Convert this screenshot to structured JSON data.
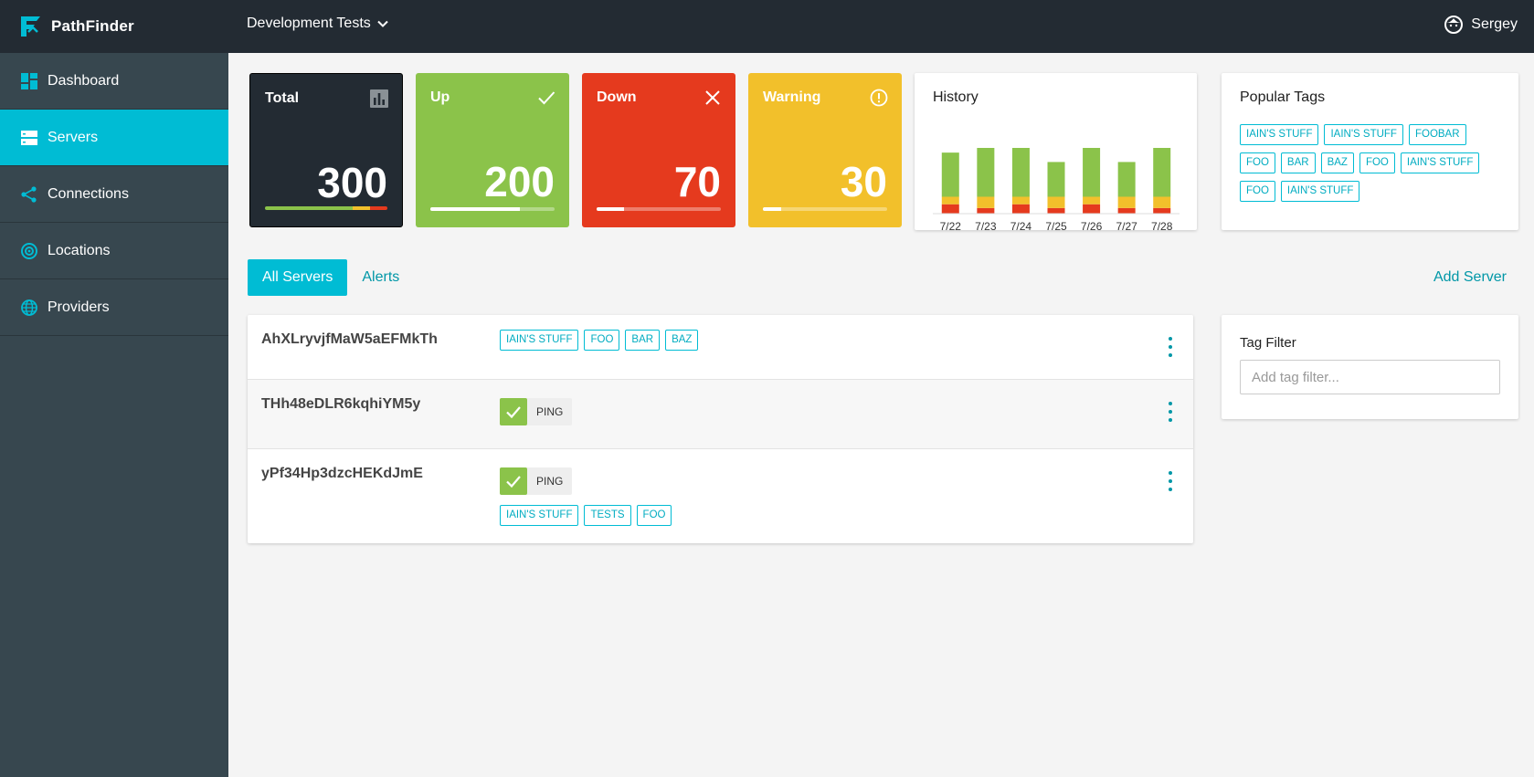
{
  "app": {
    "name": "PathFinder"
  },
  "header": {
    "project": "Development Tests",
    "user": "Sergey"
  },
  "sidebar": {
    "items": [
      {
        "label": "Dashboard",
        "icon": "dashboard-icon",
        "active": false
      },
      {
        "label": "Servers",
        "icon": "servers-icon",
        "active": true
      },
      {
        "label": "Connections",
        "icon": "share-icon",
        "active": false
      },
      {
        "label": "Locations",
        "icon": "location-icon",
        "active": false
      },
      {
        "label": "Providers",
        "icon": "globe-icon",
        "active": false
      }
    ]
  },
  "stats": {
    "total": {
      "title": "Total",
      "value": "300",
      "icon": "bar-chart-icon",
      "breakdown": {
        "up": 0.72,
        "warning": 0.14,
        "down": 0.14
      }
    },
    "up": {
      "title": "Up",
      "value": "200",
      "icon": "check-icon",
      "progress": 0.72
    },
    "down": {
      "title": "Down",
      "value": "70",
      "icon": "close-icon",
      "progress": 0.22
    },
    "warning": {
      "title": "Warning",
      "value": "30",
      "icon": "alert-circle-icon",
      "progress": 0.15
    }
  },
  "history": {
    "title": "History",
    "chart_data": {
      "type": "bar",
      "stacked": true,
      "categories": [
        "7/22",
        "7/23",
        "7/24",
        "7/25",
        "7/26",
        "7/27",
        "7/28"
      ],
      "series": [
        {
          "color": "#e53a1e",
          "values": [
            10,
            6,
            10,
            6,
            10,
            6,
            6
          ]
        },
        {
          "color": "#f2c02b",
          "values": [
            8,
            12,
            8,
            12,
            8,
            12,
            12
          ]
        },
        {
          "color": "#8bc34a",
          "values": [
            47,
            52,
            52,
            37,
            52,
            37,
            52
          ]
        }
      ]
    }
  },
  "popular_tags": {
    "title": "Popular Tags",
    "tags": [
      "IAIN'S STUFF",
      "IAIN'S STUFF",
      "FOOBAR",
      "FOO",
      "BAR",
      "BAZ",
      "FOO",
      "IAIN'S STUFF",
      "FOO",
      "IAIN'S STUFF"
    ]
  },
  "tabs": {
    "all_servers": "All Servers",
    "alerts": "Alerts",
    "add_server": "Add Server"
  },
  "servers": [
    {
      "name": "AhXLryvjfMaW5aEFMkTh",
      "tags": [
        "IAIN'S STUFF",
        "FOO",
        "BAR",
        "BAZ"
      ]
    },
    {
      "name": "THh48eDLR6kqhiYM5y",
      "check": "PING"
    },
    {
      "name": "yPf34Hp3dzcHEKdJmE",
      "check": "PING",
      "tags": [
        "IAIN'S STUFF",
        "TESTS",
        "FOO"
      ]
    }
  ],
  "tag_filter": {
    "title": "Tag Filter",
    "placeholder": "Add tag filter..."
  },
  "colors": {
    "accent": "#00bcd4",
    "sidebar": "#37474f",
    "topbar": "#232b33",
    "up": "#8bc34a",
    "down": "#e53a1e",
    "warning": "#f2c02b"
  }
}
